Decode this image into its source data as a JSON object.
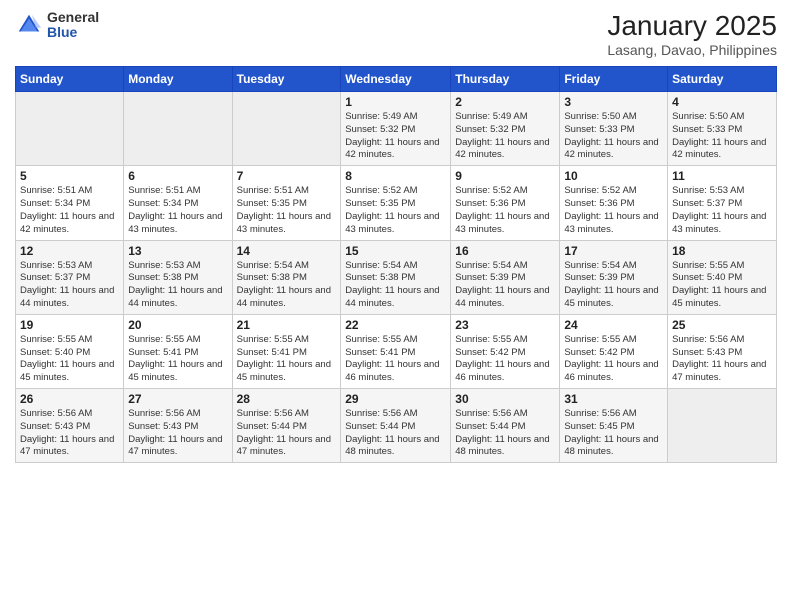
{
  "header": {
    "logo_general": "General",
    "logo_blue": "Blue",
    "month_title": "January 2025",
    "location": "Lasang, Davao, Philippines"
  },
  "days_of_week": [
    "Sunday",
    "Monday",
    "Tuesday",
    "Wednesday",
    "Thursday",
    "Friday",
    "Saturday"
  ],
  "weeks": [
    [
      {
        "day": "",
        "sunrise": "",
        "sunset": "",
        "daylight": ""
      },
      {
        "day": "",
        "sunrise": "",
        "sunset": "",
        "daylight": ""
      },
      {
        "day": "",
        "sunrise": "",
        "sunset": "",
        "daylight": ""
      },
      {
        "day": "1",
        "sunrise": "Sunrise: 5:49 AM",
        "sunset": "Sunset: 5:32 PM",
        "daylight": "Daylight: 11 hours and 42 minutes."
      },
      {
        "day": "2",
        "sunrise": "Sunrise: 5:49 AM",
        "sunset": "Sunset: 5:32 PM",
        "daylight": "Daylight: 11 hours and 42 minutes."
      },
      {
        "day": "3",
        "sunrise": "Sunrise: 5:50 AM",
        "sunset": "Sunset: 5:33 PM",
        "daylight": "Daylight: 11 hours and 42 minutes."
      },
      {
        "day": "4",
        "sunrise": "Sunrise: 5:50 AM",
        "sunset": "Sunset: 5:33 PM",
        "daylight": "Daylight: 11 hours and 42 minutes."
      }
    ],
    [
      {
        "day": "5",
        "sunrise": "Sunrise: 5:51 AM",
        "sunset": "Sunset: 5:34 PM",
        "daylight": "Daylight: 11 hours and 42 minutes."
      },
      {
        "day": "6",
        "sunrise": "Sunrise: 5:51 AM",
        "sunset": "Sunset: 5:34 PM",
        "daylight": "Daylight: 11 hours and 43 minutes."
      },
      {
        "day": "7",
        "sunrise": "Sunrise: 5:51 AM",
        "sunset": "Sunset: 5:35 PM",
        "daylight": "Daylight: 11 hours and 43 minutes."
      },
      {
        "day": "8",
        "sunrise": "Sunrise: 5:52 AM",
        "sunset": "Sunset: 5:35 PM",
        "daylight": "Daylight: 11 hours and 43 minutes."
      },
      {
        "day": "9",
        "sunrise": "Sunrise: 5:52 AM",
        "sunset": "Sunset: 5:36 PM",
        "daylight": "Daylight: 11 hours and 43 minutes."
      },
      {
        "day": "10",
        "sunrise": "Sunrise: 5:52 AM",
        "sunset": "Sunset: 5:36 PM",
        "daylight": "Daylight: 11 hours and 43 minutes."
      },
      {
        "day": "11",
        "sunrise": "Sunrise: 5:53 AM",
        "sunset": "Sunset: 5:37 PM",
        "daylight": "Daylight: 11 hours and 43 minutes."
      }
    ],
    [
      {
        "day": "12",
        "sunrise": "Sunrise: 5:53 AM",
        "sunset": "Sunset: 5:37 PM",
        "daylight": "Daylight: 11 hours and 44 minutes."
      },
      {
        "day": "13",
        "sunrise": "Sunrise: 5:53 AM",
        "sunset": "Sunset: 5:38 PM",
        "daylight": "Daylight: 11 hours and 44 minutes."
      },
      {
        "day": "14",
        "sunrise": "Sunrise: 5:54 AM",
        "sunset": "Sunset: 5:38 PM",
        "daylight": "Daylight: 11 hours and 44 minutes."
      },
      {
        "day": "15",
        "sunrise": "Sunrise: 5:54 AM",
        "sunset": "Sunset: 5:38 PM",
        "daylight": "Daylight: 11 hours and 44 minutes."
      },
      {
        "day": "16",
        "sunrise": "Sunrise: 5:54 AM",
        "sunset": "Sunset: 5:39 PM",
        "daylight": "Daylight: 11 hours and 44 minutes."
      },
      {
        "day": "17",
        "sunrise": "Sunrise: 5:54 AM",
        "sunset": "Sunset: 5:39 PM",
        "daylight": "Daylight: 11 hours and 45 minutes."
      },
      {
        "day": "18",
        "sunrise": "Sunrise: 5:55 AM",
        "sunset": "Sunset: 5:40 PM",
        "daylight": "Daylight: 11 hours and 45 minutes."
      }
    ],
    [
      {
        "day": "19",
        "sunrise": "Sunrise: 5:55 AM",
        "sunset": "Sunset: 5:40 PM",
        "daylight": "Daylight: 11 hours and 45 minutes."
      },
      {
        "day": "20",
        "sunrise": "Sunrise: 5:55 AM",
        "sunset": "Sunset: 5:41 PM",
        "daylight": "Daylight: 11 hours and 45 minutes."
      },
      {
        "day": "21",
        "sunrise": "Sunrise: 5:55 AM",
        "sunset": "Sunset: 5:41 PM",
        "daylight": "Daylight: 11 hours and 45 minutes."
      },
      {
        "day": "22",
        "sunrise": "Sunrise: 5:55 AM",
        "sunset": "Sunset: 5:41 PM",
        "daylight": "Daylight: 11 hours and 46 minutes."
      },
      {
        "day": "23",
        "sunrise": "Sunrise: 5:55 AM",
        "sunset": "Sunset: 5:42 PM",
        "daylight": "Daylight: 11 hours and 46 minutes."
      },
      {
        "day": "24",
        "sunrise": "Sunrise: 5:55 AM",
        "sunset": "Sunset: 5:42 PM",
        "daylight": "Daylight: 11 hours and 46 minutes."
      },
      {
        "day": "25",
        "sunrise": "Sunrise: 5:56 AM",
        "sunset": "Sunset: 5:43 PM",
        "daylight": "Daylight: 11 hours and 47 minutes."
      }
    ],
    [
      {
        "day": "26",
        "sunrise": "Sunrise: 5:56 AM",
        "sunset": "Sunset: 5:43 PM",
        "daylight": "Daylight: 11 hours and 47 minutes."
      },
      {
        "day": "27",
        "sunrise": "Sunrise: 5:56 AM",
        "sunset": "Sunset: 5:43 PM",
        "daylight": "Daylight: 11 hours and 47 minutes."
      },
      {
        "day": "28",
        "sunrise": "Sunrise: 5:56 AM",
        "sunset": "Sunset: 5:44 PM",
        "daylight": "Daylight: 11 hours and 47 minutes."
      },
      {
        "day": "29",
        "sunrise": "Sunrise: 5:56 AM",
        "sunset": "Sunset: 5:44 PM",
        "daylight": "Daylight: 11 hours and 48 minutes."
      },
      {
        "day": "30",
        "sunrise": "Sunrise: 5:56 AM",
        "sunset": "Sunset: 5:44 PM",
        "daylight": "Daylight: 11 hours and 48 minutes."
      },
      {
        "day": "31",
        "sunrise": "Sunrise: 5:56 AM",
        "sunset": "Sunset: 5:45 PM",
        "daylight": "Daylight: 11 hours and 48 minutes."
      },
      {
        "day": "",
        "sunrise": "",
        "sunset": "",
        "daylight": ""
      }
    ]
  ]
}
